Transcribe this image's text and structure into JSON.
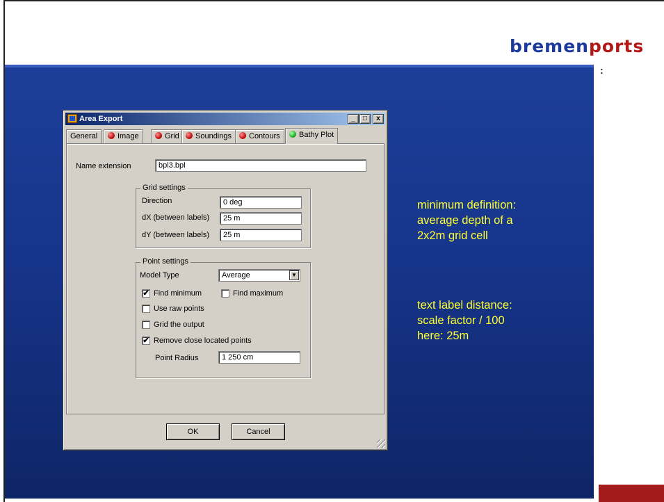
{
  "logo": {
    "part1": "bremen",
    "part2": "ports",
    "dots": ":"
  },
  "notes": {
    "minimum_definition": [
      "minimum definition:",
      "average depth of a",
      "2x2m grid cell"
    ],
    "text_label_distance": [
      "text label distance:",
      "scale factor / 100",
      "here: 25m"
    ]
  },
  "dialog": {
    "title": "Area Export",
    "window_buttons": {
      "minimize": "_",
      "maximize": "□",
      "close": "x"
    },
    "tabs": [
      "General",
      "Image",
      "Grid",
      "Soundings",
      "Contours",
      "Bathy Plot"
    ],
    "active_tab": "Bathy Plot",
    "name_extension": {
      "label": "Name extension",
      "value": "bpl3.bpl"
    },
    "grid_settings": {
      "title": "Grid settings",
      "direction": {
        "label": "Direction",
        "value": "0 deg"
      },
      "dx": {
        "label": "dX (between labels)",
        "value": "25 m"
      },
      "dy": {
        "label": "dY (between labels)",
        "value": "25 m"
      }
    },
    "point_settings": {
      "title": "Point settings",
      "model_type": {
        "label": "Model Type",
        "value": "Average"
      },
      "find_minimum": {
        "label": "Find minimum",
        "checked": true
      },
      "find_maximum": {
        "label": "Find maximum",
        "checked": false
      },
      "use_raw_points": {
        "label": "Use raw points",
        "checked": false
      },
      "grid_output": {
        "label": "Grid the output",
        "checked": false
      },
      "remove_close": {
        "label": "Remove close located points",
        "checked": true
      },
      "point_radius": {
        "label": "Point Radius",
        "value": "1 250 cm"
      }
    },
    "ok_label": "OK",
    "cancel_label": "Cancel"
  },
  "colors": {
    "slide_blue": "#1d3f9a",
    "note_yellow": "#ffff33",
    "logo_red": "#b21818",
    "corner_red": "#a31b1b"
  }
}
